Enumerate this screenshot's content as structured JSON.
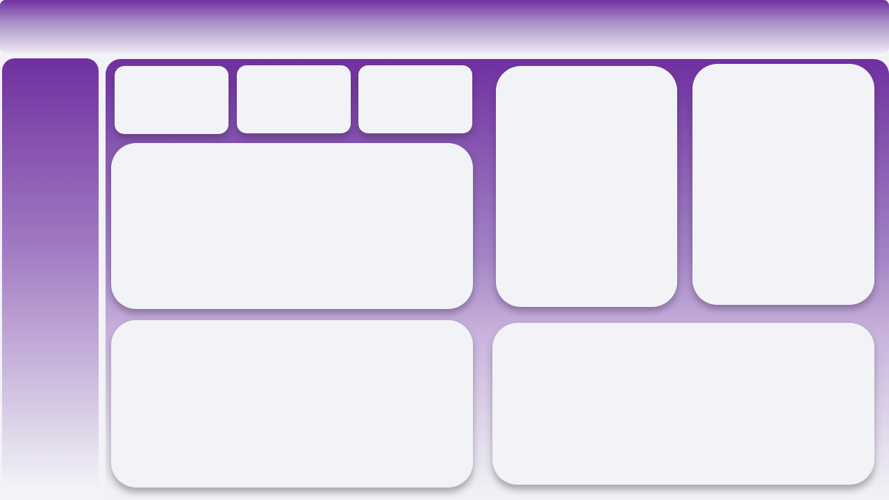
{
  "theme": {
    "accent": "#7030a0",
    "panel_background": "#f2f3f6"
  },
  "header": {},
  "sidebar": {
    "items": []
  },
  "main": {
    "kpi_cards": [
      {},
      {},
      {}
    ],
    "panels": [
      {},
      {},
      {},
      {},
      {}
    ]
  }
}
